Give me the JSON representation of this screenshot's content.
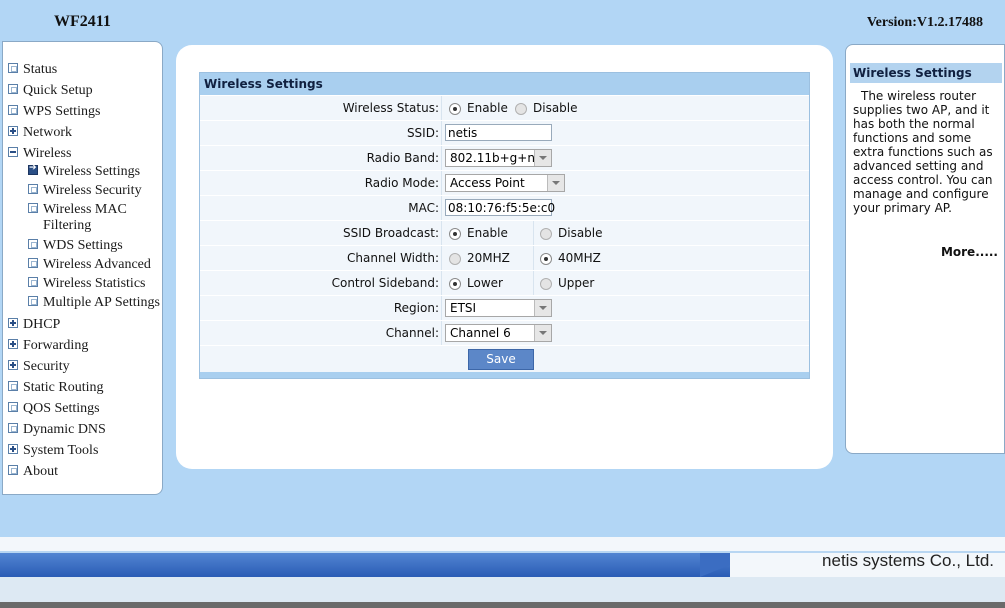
{
  "header": {
    "model": "WF2411",
    "version": "Version:V1.2.17488"
  },
  "menu": {
    "items": [
      {
        "label": "Status",
        "icon": "page-icon"
      },
      {
        "label": "Quick Setup",
        "icon": "page-icon"
      },
      {
        "label": "WPS Settings",
        "icon": "page-icon"
      },
      {
        "label": "Network",
        "icon": "plus-icon"
      },
      {
        "label": "Wireless",
        "icon": "minus-icon"
      },
      {
        "label": "Wireless Settings",
        "icon": "arrow-icon"
      },
      {
        "label": "Wireless Security",
        "icon": "page-icon"
      },
      {
        "label": "Wireless MAC",
        "label2": "Filtering",
        "icon": "page-icon"
      },
      {
        "label": "WDS Settings",
        "icon": "page-icon"
      },
      {
        "label": "Wireless Advanced",
        "icon": "page-icon"
      },
      {
        "label": "Wireless Statistics",
        "icon": "page-icon"
      },
      {
        "label": "Multiple AP Settings",
        "icon": "page-icon"
      },
      {
        "label": "DHCP",
        "icon": "plus-icon"
      },
      {
        "label": "Forwarding",
        "icon": "plus-icon"
      },
      {
        "label": "Security",
        "icon": "plus-icon"
      },
      {
        "label": "Static Routing",
        "icon": "page-icon"
      },
      {
        "label": "QOS Settings",
        "icon": "page-icon"
      },
      {
        "label": "Dynamic DNS",
        "icon": "page-icon"
      },
      {
        "label": "System Tools",
        "icon": "plus-icon"
      },
      {
        "label": "About",
        "icon": "page-icon"
      }
    ]
  },
  "form": {
    "title": "Wireless Settings",
    "wireless_status": {
      "label": "Wireless Status:",
      "opt1": "Enable",
      "opt2": "Disable"
    },
    "ssid": {
      "label": "SSID:",
      "value": "netis"
    },
    "radio_band": {
      "label": "Radio Band:",
      "value": "802.11b+g+n"
    },
    "radio_mode": {
      "label": "Radio Mode:",
      "value": "Access Point"
    },
    "mac": {
      "label": "MAC:",
      "value": "08:10:76:f5:5e:c0"
    },
    "ssid_broadcast": {
      "label": "SSID Broadcast:",
      "opt1": "Enable",
      "opt2": "Disable"
    },
    "channel_width": {
      "label": "Channel Width:",
      "opt1": "20MHZ",
      "opt2": "40MHZ"
    },
    "control_sideband": {
      "label": "Control Sideband:",
      "opt1": "Lower",
      "opt2": "Upper"
    },
    "region": {
      "label": "Region:",
      "value": "ETSI"
    },
    "channel": {
      "label": "Channel:",
      "value": "Channel 6"
    },
    "save": "Save"
  },
  "help": {
    "title": "Wireless Settings",
    "text": "The wireless router supplies two AP, and it has both the normal functions and some extra functions such as advanced setting and access control. You can manage and configure your primary AP.",
    "more": "More....."
  },
  "footer": {
    "company": "netis systems Co., Ltd."
  }
}
